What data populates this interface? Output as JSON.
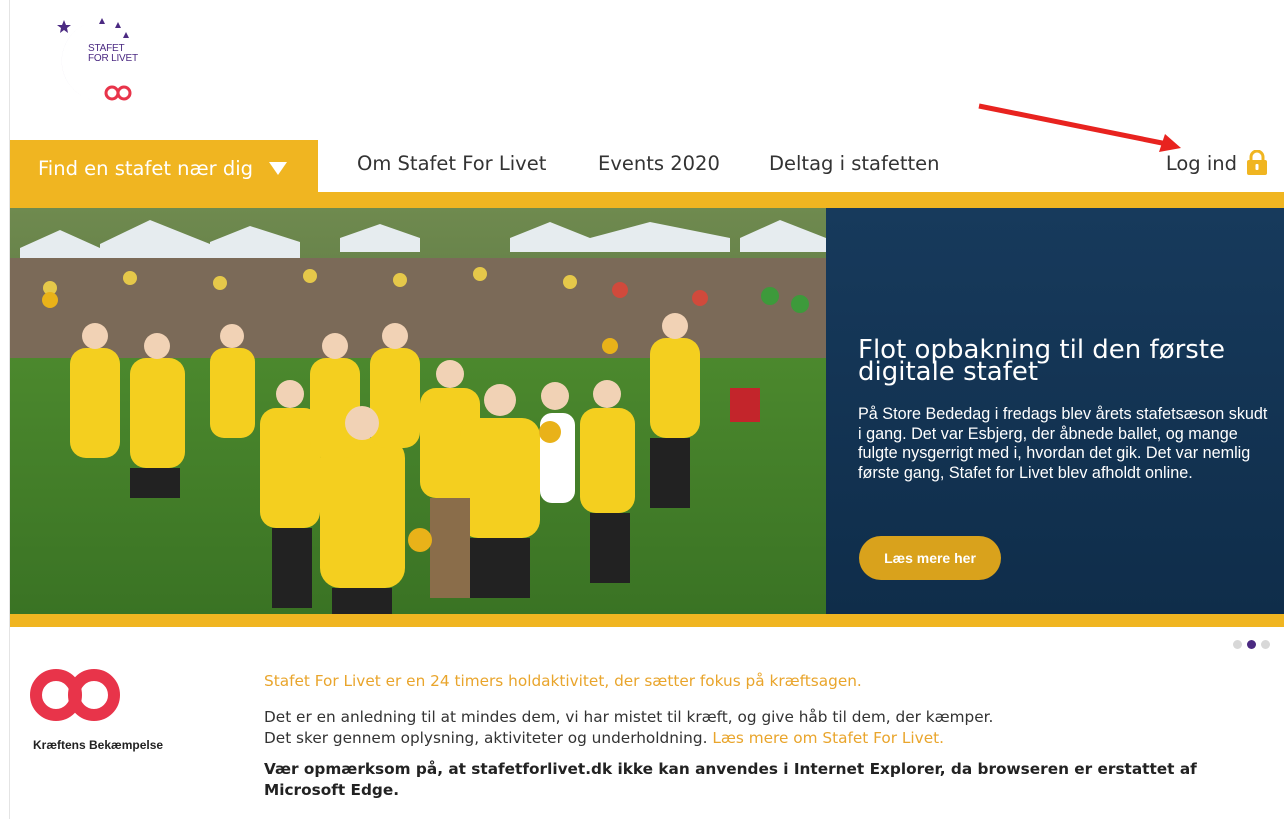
{
  "brand": {
    "logo_lines": [
      "STAFET",
      "FOR LIVET"
    ],
    "colors": {
      "purple": "#4b2a82",
      "red": "#e8344a",
      "yellow": "#f0b521",
      "navy": "#173a5c"
    }
  },
  "nav": {
    "find_label": "Find en stafet nær dig",
    "items": [
      {
        "label": "Om Stafet For Livet"
      },
      {
        "label": "Events 2020"
      },
      {
        "label": "Deltag i stafetten"
      }
    ],
    "login_label": "Log ind",
    "login_icon": "lock-icon"
  },
  "hero": {
    "title": "Flot opbakning til den første digitale stafet",
    "text": "På Store Bededag i fredags blev årets stafetsæson skudt i gang. Det var Esbjerg, der åbnede ballet, og mange fulgte nysgerrigt med i, hvordan det gik. Det var nemlig første gang, Stafet for Livet blev afholdt online.",
    "button_label": "Læs mere her"
  },
  "carousel": {
    "dots": 3,
    "active": 1
  },
  "partner": {
    "name": "Kræftens Bekæmpelse"
  },
  "info": {
    "intro": "Stafet For Livet er en 24 timers holdaktivitet, der sætter fokus på kræftsagen.",
    "line1": "Det er en anledning til at mindes dem, vi har mistet til kræft, og give håb til dem, der kæmper.",
    "line2": "Det sker gennem oplysning, aktiviteter og underholdning.",
    "read_more": "Læs mere om Stafet For Livet.",
    "warning": "Vær opmærksom på, at stafetforlivet.dk ikke kan anvendes i Internet Explorer, da browseren er erstattet af Microsoft Edge."
  }
}
